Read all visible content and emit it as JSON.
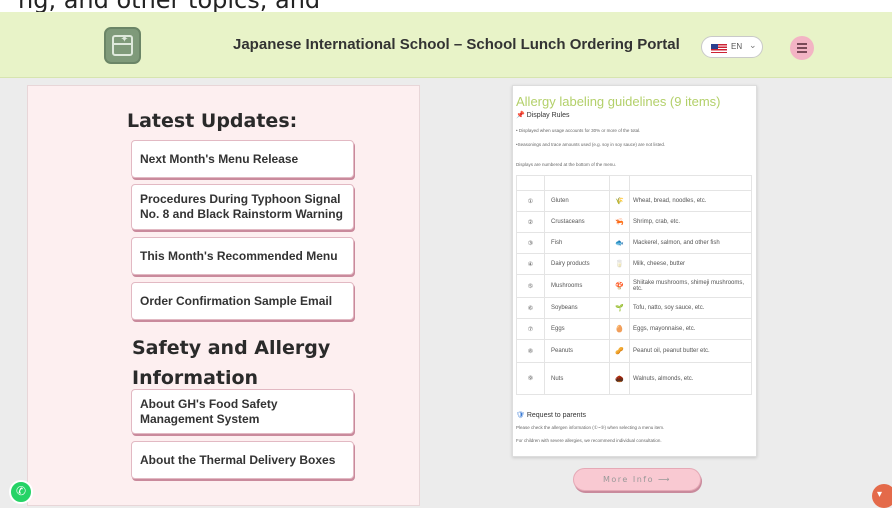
{
  "top_strip": {
    "cut_text": "ng, and other topics, and"
  },
  "header": {
    "logo_icon": "lunchbox-logo-icon",
    "title": "Japanese International School – School Lunch Ordering Portal",
    "language": {
      "code": "EN",
      "flag_icon": "us-flag-icon",
      "chevron_icon": "chevron-down-icon"
    },
    "menu_icon": "hamburger-menu-icon",
    "accent_color": "#e8f3c8"
  },
  "sidebar": {
    "updates_heading": "Latest Updates:",
    "updates": [
      {
        "label": "Next Month's Menu Release"
      },
      {
        "label": "Procedures During Typhoon Signal No. 8 and Black Rainstorm Warning"
      },
      {
        "label": "This Month's Recommended Menu"
      },
      {
        "label": "Order Confirmation Sample Email"
      }
    ],
    "safety_heading": "Safety and Allergy Information",
    "safety": [
      {
        "label": "About GH's Food Safety Management System"
      },
      {
        "label": "About the Thermal Delivery Boxes"
      }
    ],
    "panel_color": "#fdeff0"
  },
  "document": {
    "title": "Allergy labeling guidelines (9 items)",
    "display_rules": "Display Rules",
    "rule_lines": [
      "• Displayed when usage accounts for 30% or more of the total.",
      "•Seasonings and trace amounts used (e.g. soy in soy sauce) are not listed.",
      "Displays are numbered at the bottom of the menu."
    ],
    "allergens": [
      {
        "num": "①",
        "name": "Gluten",
        "icon": "🌾",
        "examples": "Wheat, bread, noodles, etc."
      },
      {
        "num": "②",
        "name": "Crustaceans",
        "icon": "🦐",
        "examples": "Shrimp, crab, etc."
      },
      {
        "num": "③",
        "name": "Fish",
        "icon": "🐟",
        "examples": "Mackerel, salmon, and other fish"
      },
      {
        "num": "④",
        "name": "Dairy products",
        "icon": "🥛",
        "examples": "Milk, cheese, butter"
      },
      {
        "num": "⑤",
        "name": "Mushrooms",
        "icon": "🍄",
        "examples": "Shiitake mushrooms, shimeji mushrooms, etc."
      },
      {
        "num": "⑥",
        "name": "Soybeans",
        "icon": "🌱",
        "examples": "Tofu, natto, soy sauce, etc."
      },
      {
        "num": "⑦",
        "name": "Eggs",
        "icon": "🥚",
        "examples": "Eggs, mayonnaise, etc."
      },
      {
        "num": "⑧",
        "name": "Peanuts",
        "icon": "🥜",
        "examples": "Peanut oil, peanut butter etc."
      },
      {
        "num": "⑨",
        "name": "Nuts",
        "icon": "🌰",
        "examples": "Walnuts, almonds, etc."
      }
    ],
    "request_heading": "Request to parents",
    "request_lines": [
      "Please check the allergen information (①~⑨) when selecting a menu item.",
      "For children with severe allergies, we recommend individual consultation."
    ]
  },
  "more_button": {
    "label": "More Info ⟶"
  },
  "floating": {
    "whatsapp_icon": "whatsapp-icon",
    "chat_icon": "chat-icon"
  }
}
